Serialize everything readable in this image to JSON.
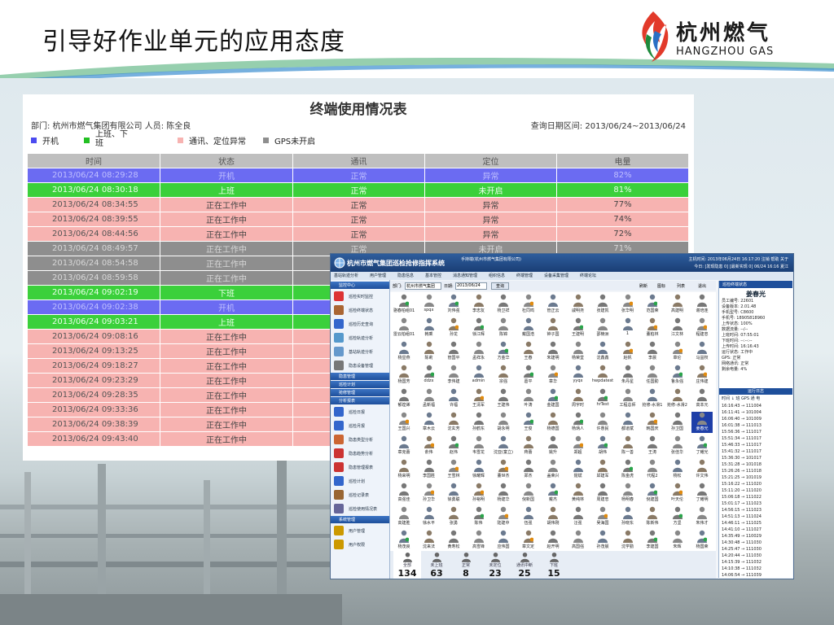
{
  "slide": {
    "title": "引导好作业单元的应用态度",
    "logo": {
      "cn": "杭州燃气",
      "en": "HANGZHOU GAS"
    }
  },
  "report": {
    "title": "终端使用情况表",
    "dept": "部门: 杭州市燃气集团有限公司 人员: 陈全良",
    "date_range": "查询日期区间: 2013/06/24~2013/06/24",
    "legend": [
      {
        "label": "开机",
        "color": "#4b4bf0"
      },
      {
        "label": "上班、下班",
        "color": "#23c023"
      },
      {
        "label": "通讯、定位异常",
        "color": "#f7b3b1"
      },
      {
        "label": "GPS未开启",
        "color": "#8e8e8e"
      }
    ],
    "columns": [
      "时间",
      "状态",
      "通讯",
      "定位",
      "电量"
    ],
    "rows": [
      {
        "kind": "blue",
        "cells": [
          "2013/06/24 08:29:28",
          "开机",
          "正常",
          "异常",
          "82%"
        ]
      },
      {
        "kind": "green",
        "cells": [
          "2013/06/24 08:30:18",
          "上班",
          "正常",
          "未开启",
          "81%"
        ]
      },
      {
        "kind": "pink",
        "cells": [
          "2013/06/24 08:34:55",
          "正在工作中",
          "正常",
          "异常",
          "77%"
        ]
      },
      {
        "kind": "pink",
        "cells": [
          "2013/06/24 08:39:55",
          "正在工作中",
          "正常",
          "异常",
          "74%"
        ]
      },
      {
        "kind": "pink",
        "cells": [
          "2013/06/24 08:44:56",
          "正在工作中",
          "正常",
          "异常",
          "72%"
        ]
      },
      {
        "kind": "gray",
        "cells": [
          "2013/06/24 08:49:57",
          "正在工作中",
          "正常",
          "未开启",
          "71%"
        ]
      },
      {
        "kind": "gray",
        "cells": [
          "2013/06/24 08:54:58",
          "正在工作中",
          "",
          "",
          ""
        ]
      },
      {
        "kind": "gray",
        "cells": [
          "2013/06/24 08:59:58",
          "正在工作中",
          "",
          "",
          ""
        ]
      },
      {
        "kind": "green",
        "cells": [
          "2013/06/24 09:02:19",
          "下班",
          "",
          "",
          ""
        ]
      },
      {
        "kind": "blue",
        "cells": [
          "2013/06/24 09:02:38",
          "开机",
          "",
          "",
          ""
        ]
      },
      {
        "kind": "green",
        "cells": [
          "2013/06/24 09:03:21",
          "上班",
          "",
          "",
          ""
        ]
      },
      {
        "kind": "pink",
        "cells": [
          "2013/06/24 09:08:16",
          "正在工作中",
          "",
          "",
          ""
        ]
      },
      {
        "kind": "pink",
        "cells": [
          "2013/06/24 09:13:25",
          "正在工作中",
          "",
          "",
          ""
        ]
      },
      {
        "kind": "pink",
        "cells": [
          "2013/06/24 09:18:27",
          "正在工作中",
          "",
          "",
          ""
        ]
      },
      {
        "kind": "pink",
        "cells": [
          "2013/06/24 09:23:29",
          "正在工作中",
          "",
          "",
          ""
        ]
      },
      {
        "kind": "pink",
        "cells": [
          "2013/06/24 09:28:35",
          "正在工作中",
          "",
          "",
          ""
        ]
      },
      {
        "kind": "pink",
        "cells": [
          "2013/06/24 09:33:36",
          "正在工作中",
          "",
          "",
          ""
        ]
      },
      {
        "kind": "pink",
        "cells": [
          "2013/06/24 09:38:39",
          "正在工作中",
          "",
          "",
          ""
        ]
      },
      {
        "kind": "pink",
        "cells": [
          "2013/06/24 09:43:40",
          "正在工作中",
          "",
          "",
          ""
        ]
      }
    ]
  },
  "app": {
    "title": "杭州市燃气集团巡检抢修指挥系统",
    "top_info": "手持端(杭州市燃气集团有限公司)",
    "top_right": "主机时间: 2013年06月24日 16:17:20    注销  帮助  关于",
    "date_line": "今日: [发现隐患 0] [最新实现 0]  06/24 16:16 夏江",
    "tabs": [
      "基站轨迹分析",
      "用户管理",
      "隐患信息",
      "基本管控",
      "消息通知管理",
      "组织信息",
      "终端管理",
      "设备采集管理",
      "终端论坛"
    ],
    "sidebar": [
      {
        "type": "header",
        "label": "监控中心"
      },
      {
        "type": "item",
        "label": "巡检实时监控",
        "color": "#d33"
      },
      {
        "type": "item",
        "label": "巡检终端状态",
        "color": "#a63"
      },
      {
        "type": "item",
        "label": "巡检历史查询",
        "color": "#36c"
      },
      {
        "type": "item",
        "label": "巡检轨迹分析",
        "color": "#59c"
      },
      {
        "type": "item",
        "label": "基站轨迹分析",
        "color": "#69c"
      },
      {
        "type": "item",
        "label": "隐患设备管理",
        "color": "#777"
      },
      {
        "type": "header",
        "label": "隐患管理"
      },
      {
        "type": "header",
        "label": "巡检计划"
      },
      {
        "type": "header",
        "label": "抢修管理"
      },
      {
        "type": "header",
        "label": "分析报表"
      },
      {
        "type": "item",
        "label": "巡检日报",
        "color": "#36c"
      },
      {
        "type": "item",
        "label": "巡检月报",
        "color": "#36c"
      },
      {
        "type": "item",
        "label": "隐患类型分析",
        "color": "#c63"
      },
      {
        "type": "item",
        "label": "隐患趋势分析",
        "color": "#c33"
      },
      {
        "type": "item",
        "label": "隐患管理报表",
        "color": "#c33"
      },
      {
        "type": "item",
        "label": "巡检计划",
        "color": "#36c"
      },
      {
        "type": "item",
        "label": "巡检记录表",
        "color": "#963"
      },
      {
        "type": "item",
        "label": "巡检使用情况表",
        "color": "#669"
      },
      {
        "type": "header",
        "label": "系统管理"
      },
      {
        "type": "item",
        "label": "用户管理",
        "color": "#c90"
      },
      {
        "type": "item",
        "label": "用户权限",
        "color": "#c90"
      }
    ],
    "toolbar": {
      "dept": "杭州市燃气集团",
      "date_label": "日期:",
      "date": "2013/06/24",
      "query": "查询",
      "refresh": "刷新",
      "icons_label": "图标",
      "list": "列表",
      "exit": "退出"
    },
    "people": [
      "骆春柏组01",
      "spqx",
      "刘伟强",
      "李忠友",
      "杨卫祥",
      "杜同鸣",
      "管正云",
      "戚明尧",
      "张建凯",
      "张华明",
      "范国荣",
      "高建明",
      "谢培连",
      "雷云柏组01",
      "韩乘",
      "孙龙",
      "徐江辉",
      "陈锦",
      "戴国浩",
      "钟子国",
      "王建明",
      "邵楠洲",
      "1",
      "董柏林",
      "江文林",
      "程建忠",
      "杨显燕",
      "陈莉",
      "管国平",
      "孟祥永",
      "方金华",
      "王春",
      "朱建明",
      "杨荣堂",
      "沈鑫鑫",
      "赵帆",
      "李晨",
      "章伦",
      "马益权",
      "杨国芳",
      "ddzx",
      "李伟建",
      "admin",
      "宗强",
      "葛平",
      "章华",
      "yyqx",
      "hwpdatest",
      "朱丹星",
      "任国勤",
      "鲁永强",
      "庄伟建",
      "郁煌烯",
      "孟新福",
      "许福",
      "王清军",
      "王建伟",
      "叶涛",
      "金建国",
      "周宇时",
      "hrTest",
      "工程总师",
      "抢修-水滑1",
      "抢修-水滑2",
      "高本元",
      "王国兴",
      "章木云",
      "沈玄芳",
      "孙鹤东",
      "胡永明",
      "王俊",
      "杨德国",
      "杨炳人",
      "许惠民",
      "都道斌",
      "韩国庆",
      "孙卫国",
      "姜春光",
      "章克蕾",
      "俞伟",
      "赵伟",
      "韦雪龙",
      "沈亚(童立)",
      "蒋蕾",
      "姚升",
      "郑超",
      "胡伟",
      "陈一善",
      "王涛",
      "张佳华",
      "丁耀光",
      "杨来明",
      "李国胜",
      "王雪林",
      "徐耀辉",
      "董世杰",
      "郑杰",
      "盖荣兴",
      "聂斌",
      "邱建军",
      "陈金虎",
      "代程2",
      "杨松",
      "许文伟",
      "高强佳",
      "孙卫华",
      "徐勇聪",
      "孙裕明",
      "杨建华",
      "倪新国",
      "戴杰",
      "黄纯林",
      "周建忠",
      "杨明春",
      "倪建国",
      "叶天伦",
      "丁耀明",
      "高建胜",
      "徐水平",
      "张勇",
      "陈伟",
      "陆建中",
      "伍强",
      "胡伟刚",
      "汪强",
      "吴海国",
      "孙晓东",
      "陈新伟",
      "方坚",
      "朱伟才",
      "杨茂良",
      "沈来法",
      "黄寿松",
      "高雪锋",
      "应伟国",
      "章文定",
      "赵开明",
      "高国强",
      "孙茂晨",
      "沈学勤",
      "李建国",
      "朱辉",
      "杨国荣"
    ],
    "selected_person": "姜春光",
    "stats": [
      {
        "label": "全部",
        "value": "134"
      },
      {
        "label": "未上班",
        "value": "63"
      },
      {
        "label": "正常",
        "value": "8"
      },
      {
        "label": "未定位",
        "value": "23"
      },
      {
        "label": "通讯中断",
        "value": "25"
      },
      {
        "label": "下班",
        "value": "15"
      }
    ],
    "detail": {
      "header": "巡检终端状态",
      "name": "姜春光",
      "lines": "员工编号: 22601\n设备版本: 2.01.48\n手机型号: C8600\n手机号: 18905818960\n上传状态: 100%\n数据流量: --/--\n上班时间: 07:55:01\n下班时间: --:--:--\n上传时间: 16:16:43\n运行状态: 工作中\nGPS: 正常\n网络通讯: 正常\n剩余电量: 4%",
      "log_header": "运行日志",
      "log_cols": "时间 ↓ 班 GPS 通 电",
      "log_lines": "16:16:43 → 111004\n16:11:41 → 101004\n16:06:40 → 101009\n16:01:38 → 111013\n15:56:36 → 111017\n15:51:34 → 111017\n15:46:33 → 111017\n15:41:32 → 111017\n15:36:30 → 101017\n15:31:28 → 101018\n15:26:26 → 111018\n15:21:25 → 101019\n15:16:22 → 111020\n15:11:20 → 111020\n15:06:18 → 111022\n15:01:17 → 111023\n14:56:15 → 111023\n14:51:13 → 111024\n14:46:11 → 111025\n14:41:10 → 111027\n14:35:49 → 110029\n14:30:48 → 111030\n14:25:47 → 111030\n14:20:44 → 111030\n14:15:39 → 111032\n14:10:38 → 111032\n14:06:54 → 111039\n14:01:53 → 111041\n13:56:52 → 111046\n13:51:52 → 111050\n13:46:52 → 111050"
    }
  }
}
